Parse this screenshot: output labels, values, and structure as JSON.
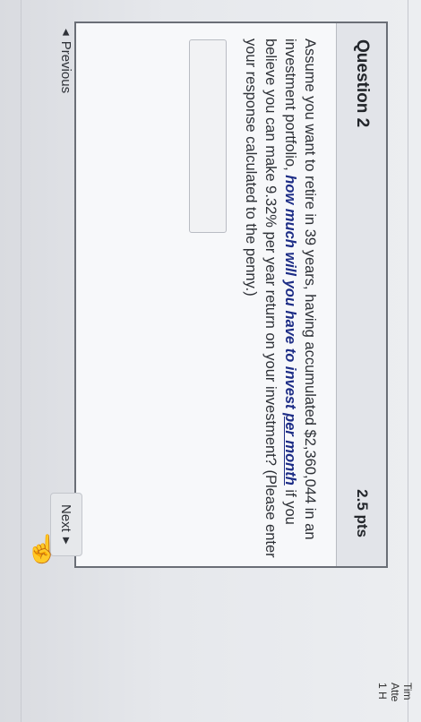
{
  "question": {
    "title": "Question 2",
    "points": "2.5 pts",
    "text_before": "Assume you want to retire in 39 years, having accumulated $2,360,044 in an investment portfolio, ",
    "text_emph": "how much will you have to invest ",
    "text_emph_u": "per month",
    "text_after": " if you believe you can make 9.32% per year return on your investment? (Please enter your response calculated to the penny.)",
    "answer_value": ""
  },
  "side": {
    "line1": "Tim",
    "line2": "Atte",
    "line3": "1 H"
  },
  "nav": {
    "previous_label": "Previous",
    "next_label": "Next",
    "prev_icon": "◀",
    "next_icon": "▶"
  },
  "cursor_icon": "☝"
}
